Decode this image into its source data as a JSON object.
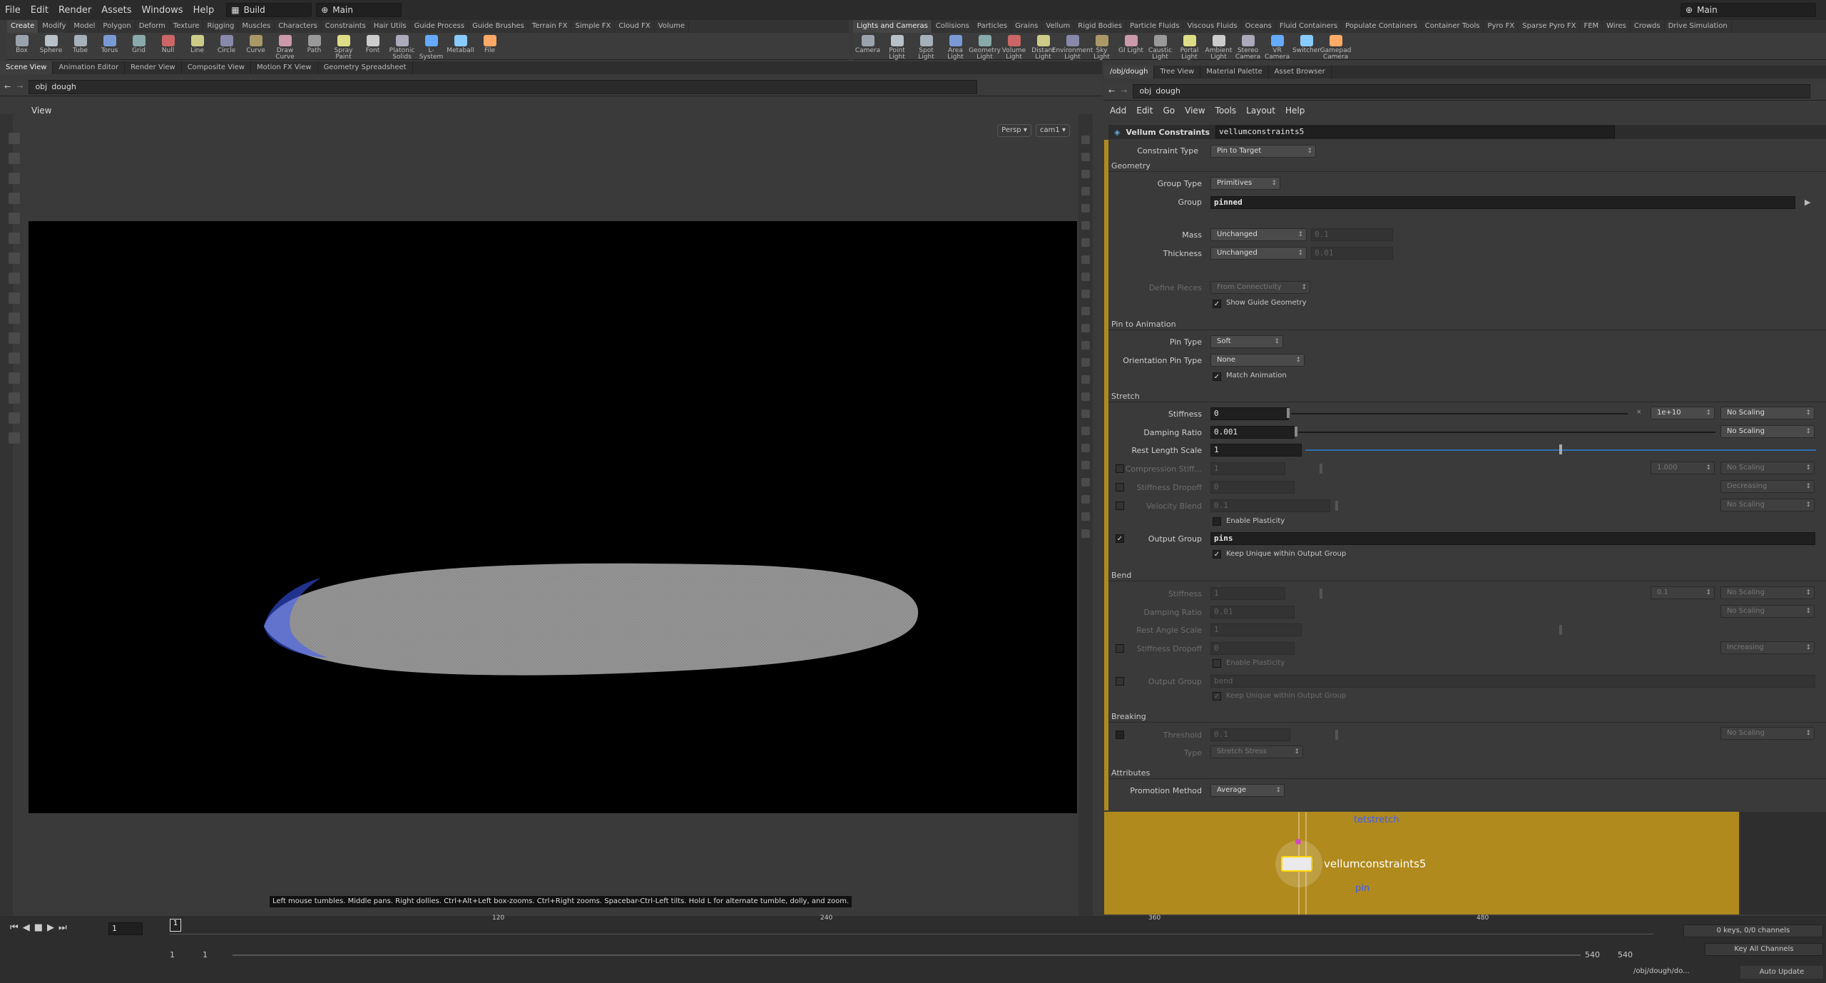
{
  "menu": {
    "items": [
      "File",
      "Edit",
      "Render",
      "Assets",
      "Windows",
      "Help"
    ],
    "desktop": "Build",
    "context": "Main",
    "right_context": "Main"
  },
  "shelf_left": {
    "tabs": [
      "Create",
      "Modify",
      "Model",
      "Polygon",
      "Deform",
      "Texture",
      "Rigging",
      "Muscles",
      "Characters",
      "Constraints",
      "Hair Utils",
      "Guide Process",
      "Guide Brushes",
      "Terrain FX",
      "Simple FX",
      "Cloud FX",
      "Volume"
    ]
  },
  "shelf_right": {
    "tabs": [
      "Lights and Cameras",
      "Collisions",
      "Particles",
      "Grains",
      "Vellum",
      "Rigid Bodies",
      "Particle Fluids",
      "Viscous Fluids",
      "Oceans",
      "Fluid Containers",
      "Populate Containers",
      "Container Tools",
      "Pyro FX",
      "Sparse Pyro FX",
      "FEM",
      "Wires",
      "Crowds",
      "Drive Simulation"
    ]
  },
  "tools_left": [
    "Box",
    "Sphere",
    "Tube",
    "Torus",
    "Grid",
    "Null",
    "Line",
    "Circle",
    "Curve",
    "Draw Curve",
    "Path",
    "Spray Paint",
    "Font",
    "Platonic Solids",
    "L-System",
    "Metaball",
    "File"
  ],
  "tools_right": [
    "Camera",
    "Point Light",
    "Spot Light",
    "Area Light",
    "Geometry Light",
    "Volume Light",
    "Distant Light",
    "Environment Light",
    "Sky Light",
    "GI Light",
    "Caustic Light",
    "Portal Light",
    "Ambient Light",
    "Stereo Camera",
    "VR Camera",
    "Switcher",
    "Gamepad Camera"
  ],
  "viewer": {
    "tabs": [
      "Scene View",
      "Animation Editor",
      "Render View",
      "Composite View",
      "Motion FX View",
      "Geometry Spreadsheet"
    ],
    "path_obj": "obj",
    "path_node": "dough",
    "title": "View",
    "persp": "Persp",
    "cam": "cam1",
    "hint": "Left mouse tumbles. Middle pans. Right dollies. Ctrl+Alt+Left box-zooms. Ctrl+Right zooms. Spacebar-Ctrl-Left tilts. Hold L for alternate tumble, dolly, and zoom."
  },
  "params": {
    "tabs": [
      "/obj/dough",
      "Tree View",
      "Material Palette",
      "Asset Browser"
    ],
    "path_obj": "obj",
    "path_node": "dough",
    "menus": [
      "Add",
      "Edit",
      "Go",
      "View",
      "Tools",
      "Layout",
      "Help"
    ],
    "node_type": "Vellum Constraints",
    "node_name": "vellumconstraints5",
    "constraint_type_label": "Constraint Type",
    "constraint_type": "Pin to Target",
    "geometry": {
      "title": "Geometry",
      "group_type_label": "Group Type",
      "group_type": "Primitives",
      "group_label": "Group",
      "group": "pinned",
      "mass_label": "Mass",
      "mass": "Unchanged",
      "mass_val": "0.1",
      "thickness_label": "Thickness",
      "thickness": "Unchanged",
      "thickness_val": "0.01",
      "define_label": "Define Pieces",
      "define": "From Connectivity",
      "show_guide": "Show Guide Geometry"
    },
    "pin": {
      "title": "Pin to Animation",
      "pin_type_label": "Pin Type",
      "pin_type": "Soft",
      "orient_label": "Orientation Pin Type",
      "orient": "None",
      "match": "Match Animation"
    },
    "stretch": {
      "title": "Stretch",
      "stiff_label": "Stiffness",
      "stiff": "0",
      "stiff_mult": "1e+10",
      "stiff_scale": "No Scaling",
      "damp_label": "Damping Ratio",
      "damp": "0.001",
      "damp_scale": "No Scaling",
      "rest_label": "Rest Length Scale",
      "rest": "1",
      "comp_label": "Compression Stiff...",
      "comp": "1",
      "comp_mult": "1.000",
      "comp_scale": "No Scaling",
      "drop_label": "Stiffness Dropoff",
      "drop": "0",
      "drop_mode": "Decreasing",
      "vel_label": "Velocity Blend",
      "vel": "0.1",
      "vel_scale": "No Scaling",
      "plast": "Enable Plasticity",
      "out_label": "Output Group",
      "out": "pins",
      "unique": "Keep Unique within Output Group"
    },
    "bend": {
      "title": "Bend",
      "stiff_label": "Stiffness",
      "stiff": "1",
      "stiff_mult": "0.1",
      "stiff_scale": "No Scaling",
      "damp_label": "Damping Ratio",
      "damp": "0.01",
      "damp_scale": "No Scaling",
      "rest_label": "Rest Angle Scale",
      "rest": "1",
      "drop_label": "Stiffness Dropoff",
      "drop": "0",
      "drop_mode": "Increasing",
      "plast": "Enable Plasticity",
      "out_label": "Output Group",
      "out": "bend",
      "unique": "Keep Unique within Output Group"
    },
    "breaking": {
      "title": "Breaking",
      "thresh_label": "Threshold",
      "thresh": "0.1",
      "thresh_scale": "No Scaling",
      "type_label": "Type",
      "type": "Stretch Stress"
    },
    "attributes": {
      "title": "Attributes",
      "promo_label": "Promotion Method",
      "promo": "Average"
    }
  },
  "network": {
    "node_above": "tetstretch",
    "node": "vellumconstraints5",
    "node_below": "pin"
  },
  "timeline": {
    "frame": "1",
    "ticks": [
      "120",
      "240",
      "360",
      "480"
    ],
    "start": "1",
    "start2": "1",
    "end": "540",
    "end2": "540",
    "keys": "0 keys, 0/0 channels",
    "key_all": "Key All Channels",
    "path": "/obj/dough/do...",
    "auto": "Auto Update"
  },
  "colors": {
    "network_bg": "#b08a1c",
    "selection": "#3b5bff"
  }
}
